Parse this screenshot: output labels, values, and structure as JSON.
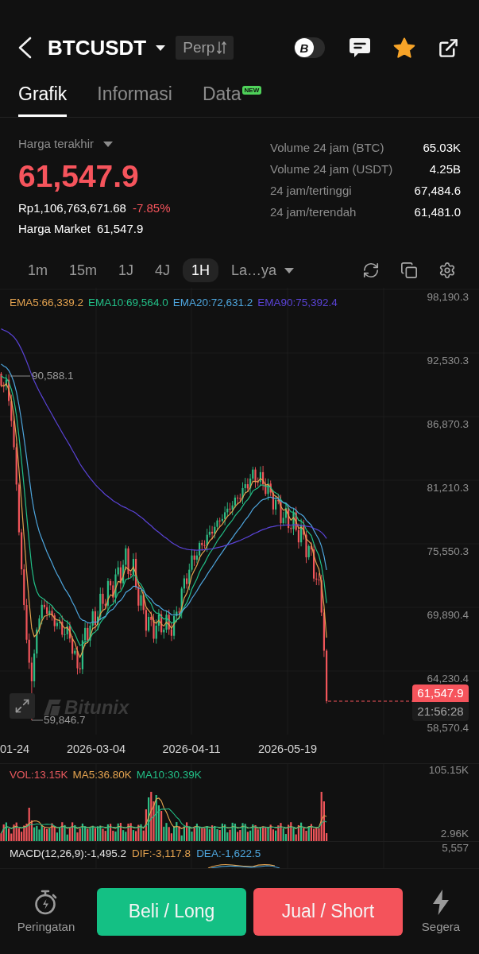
{
  "header": {
    "symbol": "BTCUSDT",
    "contract_type": "Perp",
    "mode_toggle": {
      "label": "B",
      "on": false
    },
    "favorite": true
  },
  "tabs": [
    {
      "label": "Grafik",
      "selected": true
    },
    {
      "label": "Informasi",
      "selected": false
    },
    {
      "label": "Data",
      "selected": false,
      "badge": "NEW"
    }
  ],
  "price": {
    "label": "Harga terakhir",
    "last": "61,547.9",
    "falling": true,
    "fiat": "Rp1,106,763,671.68",
    "change": "-7.85%",
    "market_label": "Harga Market",
    "market_price": "61,547.9"
  },
  "stats": [
    {
      "label": "Volume 24 jam (BTC)",
      "value": "65.03K"
    },
    {
      "label": "Volume 24 jam (USDT)",
      "value": "4.25B"
    },
    {
      "label": "24 jam/tertinggi",
      "value": "67,484.6"
    },
    {
      "label": "24 jam/terendah",
      "value": "61,481.0"
    }
  ],
  "intervals": [
    {
      "label": "1m",
      "selected": false
    },
    {
      "label": "15m",
      "selected": false
    },
    {
      "label": "1J",
      "selected": false
    },
    {
      "label": "4J",
      "selected": false
    },
    {
      "label": "1H",
      "selected": true
    }
  ],
  "interval_more": "La…ya",
  "chart": {
    "indicators": [
      {
        "label": "EMA5:66,339.2",
        "color": "#e3a24f"
      },
      {
        "label": "EMA10:69,564.0",
        "color": "#22bf87"
      },
      {
        "label": "EMA20:72,631.2",
        "color": "#4ea6de"
      },
      {
        "label": "EMA90:75,392.4",
        "color": "#5a43d6"
      }
    ],
    "y_axis": [
      "98,190.3",
      "92,530.3",
      "86,870.3",
      "81,210.3",
      "75,550.3",
      "69,890.4",
      "64,230.4",
      "58,570.4"
    ],
    "high_marker": "90,588.1",
    "low_marker": "59,846.7",
    "price_tag": "61,547.9",
    "countdown": "21:56:28",
    "watermark": "Bitunix",
    "x_axis": [
      "01-24",
      "2026-03-04",
      "2026-04-11",
      "2026-05-19"
    ]
  },
  "volume": {
    "indicators": [
      {
        "label": "VOL:13.15K",
        "color": "#e8595e"
      },
      {
        "label": "MA5:36.80K",
        "color": "#e3a24f"
      },
      {
        "label": "MA10:30.39K",
        "color": "#22bf87"
      }
    ],
    "y_axis": [
      "105.15K",
      "2.96K"
    ]
  },
  "macd": {
    "indicators": [
      {
        "label": "MACD(12,26,9):-1,495.2",
        "color": "#e6e6e6"
      },
      {
        "label": "DIF:-3,117.8",
        "color": "#e3a24f"
      },
      {
        "label": "DEA:-1,622.5",
        "color": "#4ea6de"
      }
    ],
    "y_axis": [
      "5,557"
    ]
  },
  "actions": [
    {
      "kind": "alert",
      "label": "Peringatan"
    },
    {
      "kind": "buy",
      "label": "Beli / Long"
    },
    {
      "kind": "sell",
      "label": "Jual / Short"
    },
    {
      "kind": "instant",
      "label": "Segera"
    }
  ]
}
